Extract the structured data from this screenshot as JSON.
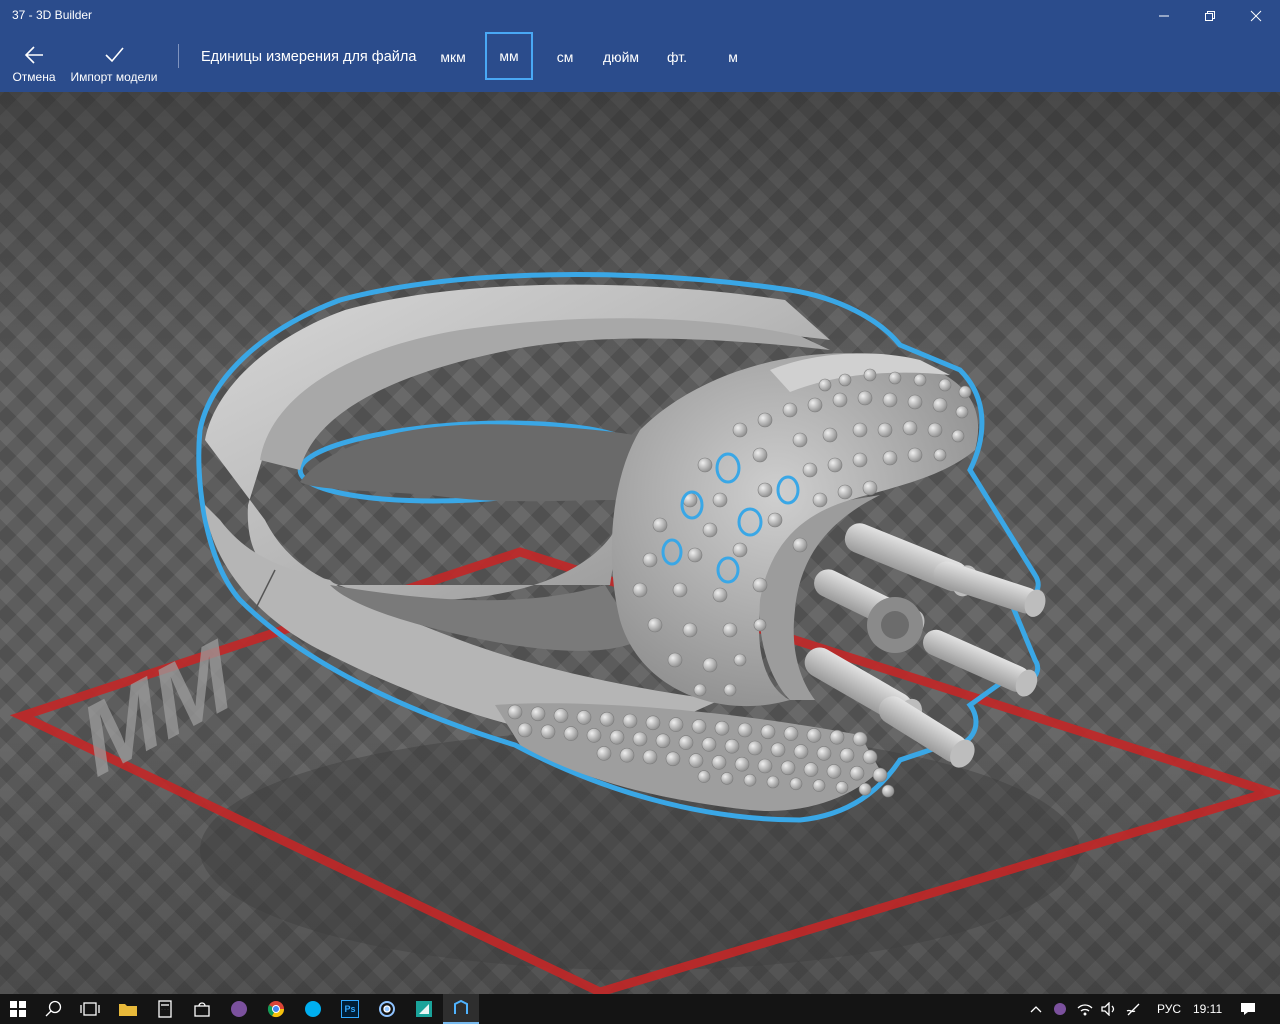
{
  "window": {
    "title": "37 - 3D Builder"
  },
  "toolbar": {
    "cancel_label": "Отмена",
    "import_label": "Импорт модели",
    "units_label": "Единицы измерения для файла",
    "units": [
      "мкм",
      "мм",
      "см",
      "дюйм",
      "фт.",
      "м"
    ],
    "selected_unit": "мм"
  },
  "viewport": {
    "plate_marking": "MM"
  },
  "taskbar": {
    "apps": [
      "start-icon",
      "search-icon",
      "task-view-icon",
      "file-explorer-icon",
      "calculator-icon",
      "store-icon",
      "viber-icon",
      "chrome-icon",
      "skype-icon",
      "photoshop-icon",
      "app-icon",
      "app2-icon",
      "3d-builder-icon"
    ],
    "photoshop_text": "Ps",
    "language": "РУС",
    "time": "19:11"
  },
  "colors": {
    "accent": "#2b4c8c",
    "selection_outline": "#3aa7e6",
    "build_plate": "#cc2626"
  }
}
